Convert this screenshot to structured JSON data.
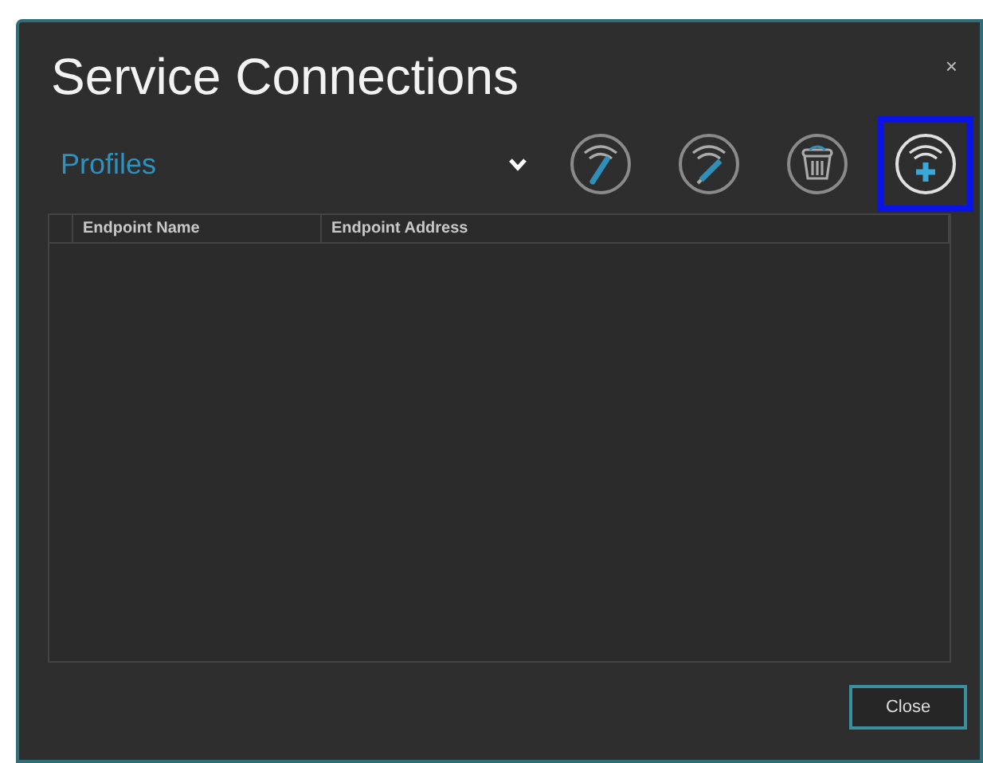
{
  "window": {
    "title": "Service Connections",
    "close_glyph": "×"
  },
  "profiles": {
    "label": "Profiles"
  },
  "toolbar": [
    {
      "kind": "edit",
      "highlighted": false
    },
    {
      "kind": "rename",
      "highlighted": false
    },
    {
      "kind": "delete",
      "highlighted": false
    },
    {
      "kind": "add",
      "highlighted": true
    }
  ],
  "table": {
    "columns": [
      "Endpoint Name",
      "Endpoint Address"
    ]
  },
  "buttons": [
    "Close"
  ]
}
